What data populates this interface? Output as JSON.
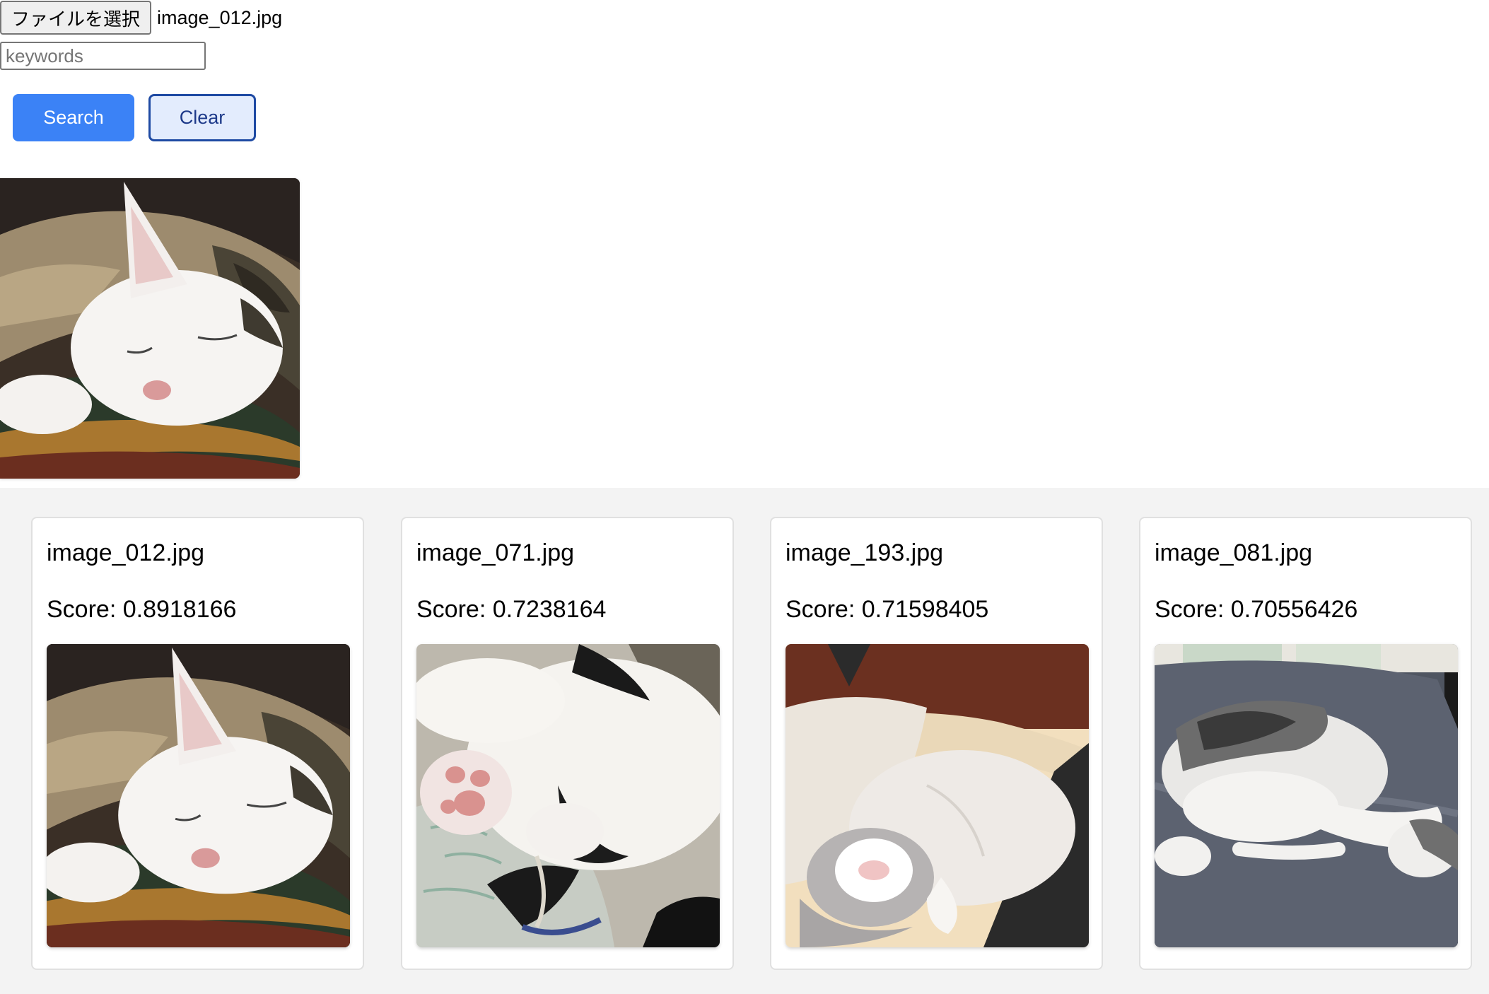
{
  "file_input": {
    "button_label": "ファイルを選択",
    "file_name": "image_012.jpg"
  },
  "search": {
    "placeholder": "keywords",
    "value": "",
    "search_label": "Search",
    "clear_label": "Clear"
  },
  "colors": {
    "search_button": "#3b82f6",
    "clear_button_bg": "#e3ecfd",
    "clear_button_border": "#1e4aa3",
    "results_bg": "#f3f3f3"
  },
  "preview": {
    "image_name": "image_012.jpg"
  },
  "results": [
    {
      "file_name": "image_012.jpg",
      "score_text": "Score: 0.8918166"
    },
    {
      "file_name": "image_071.jpg",
      "score_text": "Score: 0.7238164"
    },
    {
      "file_name": "image_193.jpg",
      "score_text": "Score: 0.71598405"
    },
    {
      "file_name": "image_081.jpg",
      "score_text": "Score: 0.70556426"
    }
  ]
}
